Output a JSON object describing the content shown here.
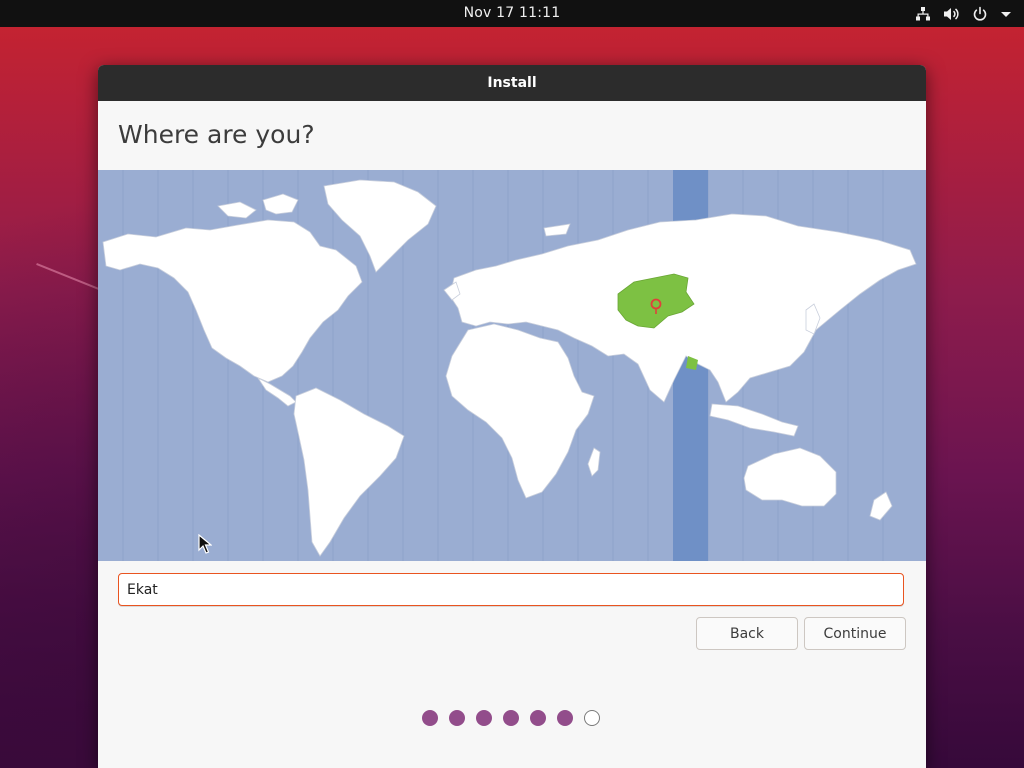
{
  "topbar": {
    "clock": "Nov 17  11:11",
    "icons": [
      "network-icon",
      "volume-icon",
      "power-icon",
      "system-menu-arrow-icon"
    ]
  },
  "window": {
    "title": "Install"
  },
  "page": {
    "heading": "Where are you?"
  },
  "map": {
    "selected_region": "Yekaterinburg timezone (Kazakhstan highlighted)",
    "colors": {
      "ocean": "#9aadd2",
      "land": "#ffffff",
      "selected_zone_band": "#6f90c6",
      "selected_country": "#7dc143",
      "pin": "#e0403a"
    }
  },
  "search": {
    "value": "Ekat"
  },
  "buttons": {
    "back": "Back",
    "continue": "Continue"
  },
  "progress": {
    "total_steps": 7,
    "completed_steps": 6,
    "accent": "#924d8b"
  },
  "colors": {
    "accent": "#e95420"
  }
}
